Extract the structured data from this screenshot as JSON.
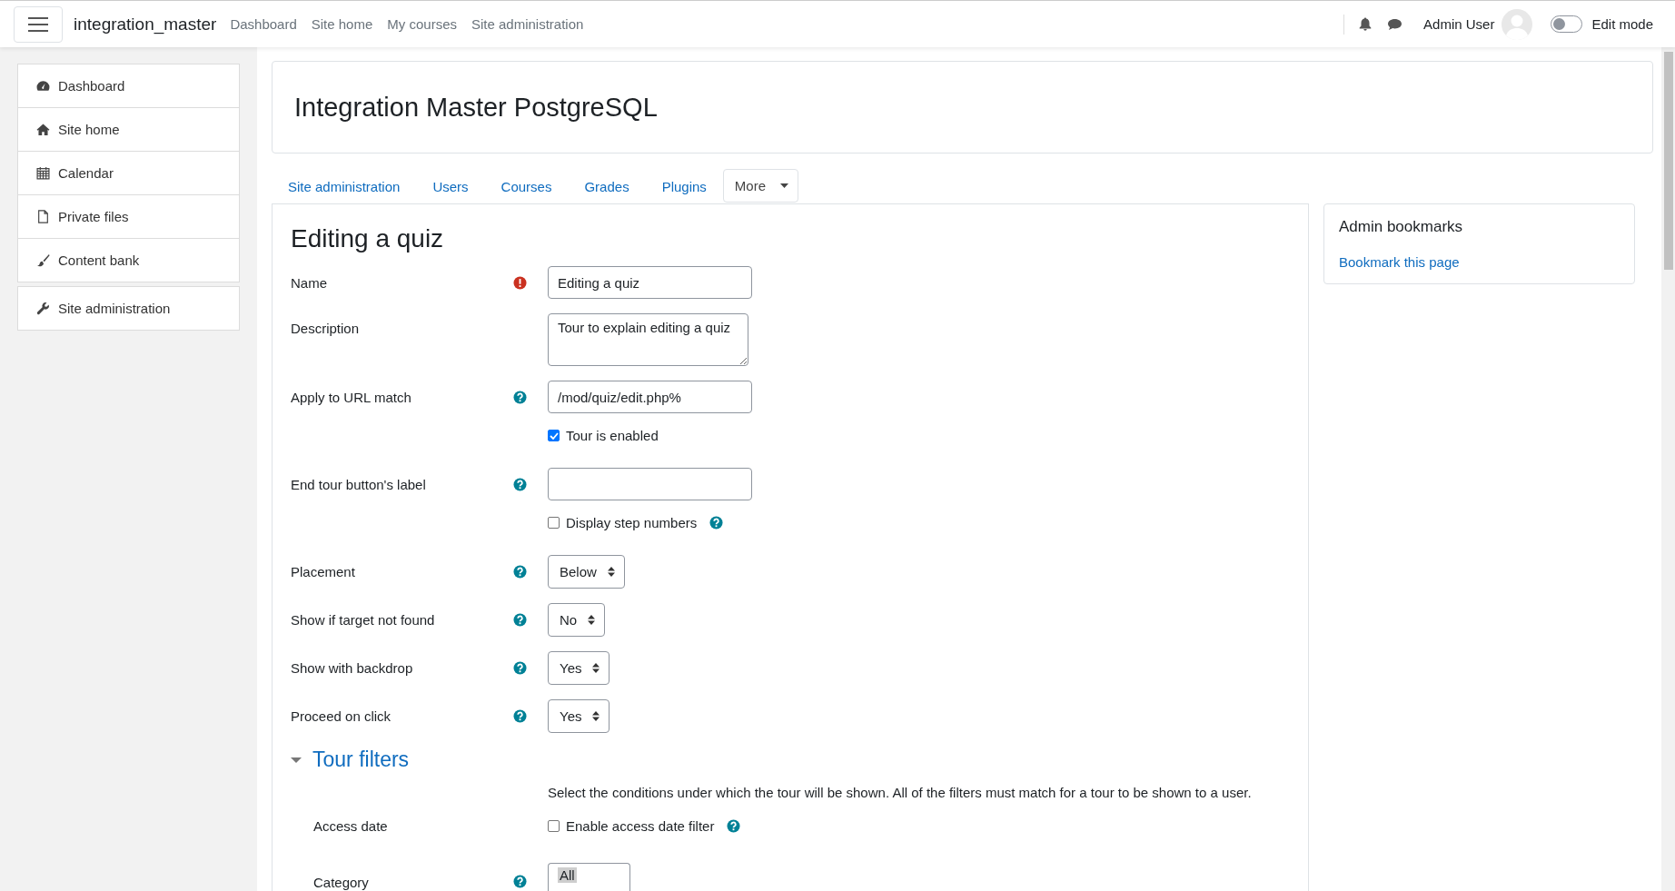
{
  "navbar": {
    "brand": "integration_master",
    "links": [
      "Dashboard",
      "Site home",
      "My courses",
      "Site administration"
    ],
    "user": "Admin User",
    "edit_mode": {
      "label": "Edit mode",
      "on": false
    }
  },
  "sidebar": {
    "groups": [
      [
        {
          "label": "Dashboard"
        },
        {
          "label": "Site home"
        },
        {
          "label": "Calendar"
        },
        {
          "label": "Private files"
        },
        {
          "label": "Content bank"
        }
      ],
      [
        {
          "label": "Site administration"
        }
      ]
    ]
  },
  "header": {
    "title": "Integration Master PostgreSQL"
  },
  "tabs": [
    {
      "label": "Site administration",
      "kind": "link",
      "selected": false
    },
    {
      "label": "Users",
      "kind": "link",
      "selected": false
    },
    {
      "label": "Courses",
      "kind": "link",
      "selected": false
    },
    {
      "label": "Grades",
      "kind": "link",
      "selected": false
    },
    {
      "label": "Plugins",
      "kind": "link",
      "selected": false
    },
    {
      "label": "More",
      "kind": "dropdown",
      "selected": true
    }
  ],
  "form": {
    "title": "Editing a quiz",
    "fields": [
      {
        "kind": "text",
        "label": "Name",
        "required": true,
        "help": false,
        "value": "Editing a quiz"
      },
      {
        "kind": "textarea",
        "label": "Description",
        "required": false,
        "help": false,
        "value": "Tour to explain editing a quiz"
      },
      {
        "kind": "text",
        "label": "Apply to URL match",
        "required": false,
        "help": true,
        "value": "/mod/quiz/edit.php%"
      },
      {
        "kind": "checkbox",
        "text": "Tour is enabled",
        "checked": true,
        "help": false
      },
      {
        "kind": "text",
        "label": "End tour button's label",
        "required": false,
        "help": true
      },
      {
        "kind": "checkbox",
        "text": "Display step numbers",
        "checked": false,
        "help": true
      },
      {
        "kind": "select",
        "label": "Placement",
        "required": false,
        "help": true,
        "value": "Below"
      },
      {
        "kind": "select",
        "label": "Show if target not found",
        "required": false,
        "help": true,
        "value": "No"
      },
      {
        "kind": "select",
        "label": "Show with backdrop",
        "required": false,
        "help": true,
        "value": "Yes"
      },
      {
        "kind": "select",
        "label": "Proceed on click",
        "required": false,
        "help": true,
        "value": "Yes"
      }
    ],
    "section": {
      "title": "Tour filters",
      "expanded": true,
      "intro": "Select the conditions under which the tour will be shown. All of the filters must match for a tour to be shown to a user.",
      "fields": [
        {
          "kind": "checkbox",
          "label": "Access date",
          "text": "Enable access date filter",
          "checked": false,
          "help": true
        },
        {
          "kind": "listbox",
          "label": "Category",
          "help": true,
          "options": [
            {
              "label": "All",
              "selected": true
            }
          ]
        }
      ]
    }
  },
  "bookmarks": {
    "title": "Admin bookmarks",
    "link": "Bookmark this page"
  }
}
